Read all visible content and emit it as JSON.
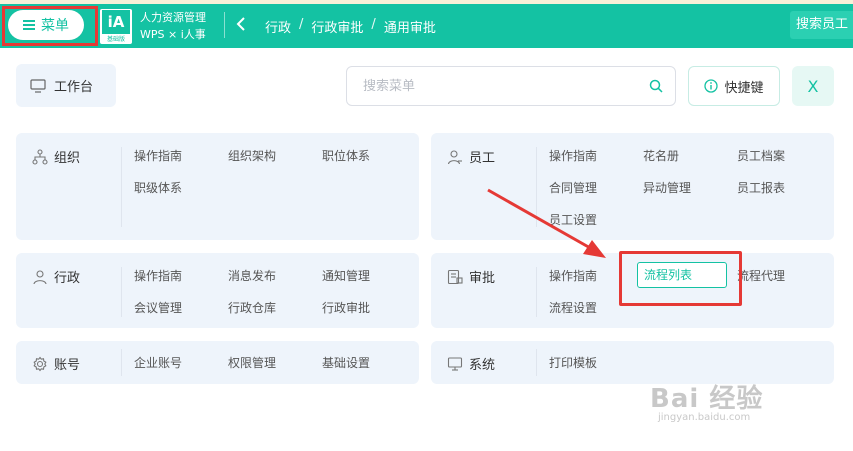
{
  "topbar": {
    "menu_label": "菜单",
    "logo_text": "iA",
    "logo_subtext": "基础版",
    "app_name_line1": "人力资源管理",
    "app_name_line2": "WPS × i人事",
    "breadcrumb": [
      "行政",
      "行政审批",
      "通用审批"
    ],
    "breadcrumb_sep": "/",
    "search_employee": "搜索员工"
  },
  "panel": {
    "workbench_label": "工作台",
    "search": {
      "placeholder": "搜索菜单",
      "value": ""
    },
    "shortcut_label": "快捷键",
    "close_label": "X",
    "sections": [
      {
        "title": "组织",
        "icon": "org-icon",
        "items": [
          "操作指南",
          "组织架构",
          "职位体系",
          "职级体系"
        ]
      },
      {
        "title": "员工",
        "icon": "person-icon",
        "items": [
          "操作指南",
          "花名册",
          "员工档案",
          "合同管理",
          "异动管理",
          "员工报表",
          "员工设置"
        ]
      },
      {
        "title": "行政",
        "icon": "person-icon",
        "items": [
          "操作指南",
          "消息发布",
          "通知管理",
          "会议管理",
          "行政仓库",
          "行政审批"
        ]
      },
      {
        "title": "审批",
        "icon": "approval-icon",
        "items": [
          "操作指南",
          "流程列表",
          "流程代理",
          "流程设置"
        ]
      },
      {
        "title": "账号",
        "icon": "gear-icon",
        "items": [
          "企业账号",
          "权限管理",
          "基础设置"
        ]
      },
      {
        "title": "系统",
        "icon": "monitor-icon",
        "items": [
          "打印模板"
        ]
      }
    ]
  },
  "watermark": {
    "line1": "Bai 经验",
    "line2": "jingyan.baidu.com"
  },
  "colors": {
    "accent": "#14c2a3",
    "highlight": "#e53935",
    "card_bg": "#eef4fb"
  }
}
